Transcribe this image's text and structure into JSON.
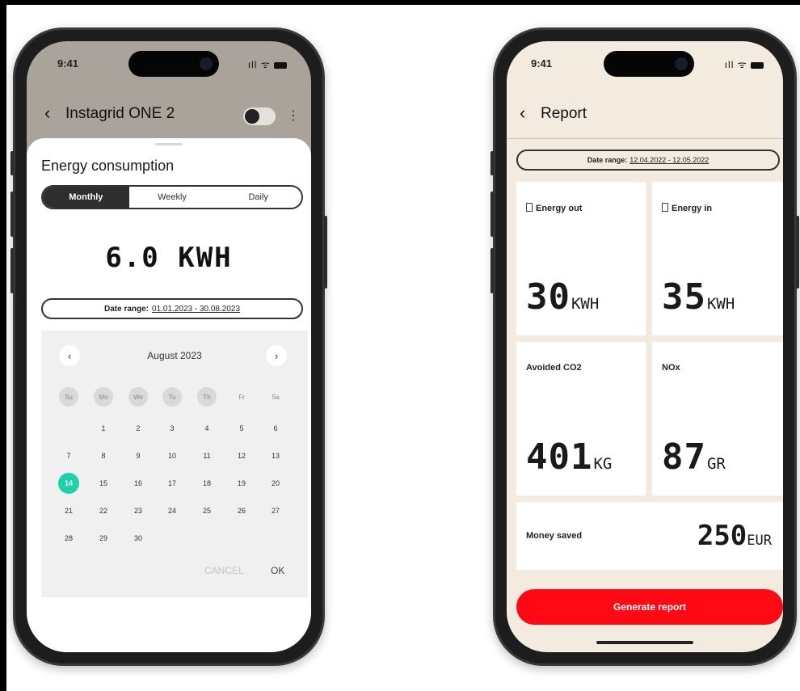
{
  "left_phone": {
    "status": {
      "time": "9:41",
      "icons": "ıll ᯤ"
    },
    "header": {
      "back_icon": "‹",
      "title": "Instagrid ONE 2",
      "menu_icon": "⋮"
    },
    "sheet": {
      "title": "Energy consumption",
      "tabs": [
        {
          "label": "Monthly",
          "selected": true
        },
        {
          "label": "Weekly",
          "selected": false
        },
        {
          "label": "Daily",
          "selected": false
        }
      ],
      "value": "6.0 KWH",
      "date_range_label": "Date range:",
      "date_range_value": "01.01.2023 - 30.08.2023"
    },
    "calendar": {
      "prev_icon": "‹",
      "next_icon": "›",
      "month": "August 2023",
      "weekdays": [
        "Su",
        "Mo",
        "We",
        "Tu",
        "Th",
        "Fr",
        "Sa"
      ],
      "rows": [
        [
          "",
          "1",
          "2",
          "3",
          "4",
          "5",
          "6"
        ],
        [
          "7",
          "8",
          "9",
          "10",
          "11",
          "12",
          "13"
        ],
        [
          "14",
          "15",
          "16",
          "17",
          "18",
          "19",
          "20"
        ],
        [
          "21",
          "22",
          "23",
          "24",
          "25",
          "26",
          "27"
        ],
        [
          "28",
          "29",
          "30",
          "",
          "",
          "",
          ""
        ]
      ],
      "selected_day": "14",
      "cancel_label": "CANCEL",
      "ok_label": "OK"
    }
  },
  "right_phone": {
    "status": {
      "time": "9:41",
      "icons": "ıll ᯤ"
    },
    "header": {
      "back_icon": "‹",
      "title": "Report"
    },
    "date_range_label": "Date range:",
    "date_range_value": "12.04.2022 - 12.05.2022",
    "cards": {
      "energy_out": {
        "label": "Energy out",
        "value": "30",
        "unit": "KWH"
      },
      "energy_in": {
        "label": "Energy in",
        "value": "35",
        "unit": "KWH"
      },
      "co2": {
        "label": "Avoided CO2",
        "value": "401",
        "unit": "KG"
      },
      "nox": {
        "label": "NOx",
        "value": "87",
        "unit": "GR"
      },
      "money": {
        "label": "Money saved",
        "value": "250",
        "unit": "EUR"
      }
    },
    "generate_label": "Generate report"
  },
  "colors": {
    "accent_red": "#ff0a14",
    "selected_day": "#1fd1a8",
    "right_screen_bg": "#f3ebe0",
    "left_header_bg": "#a9a39b"
  }
}
